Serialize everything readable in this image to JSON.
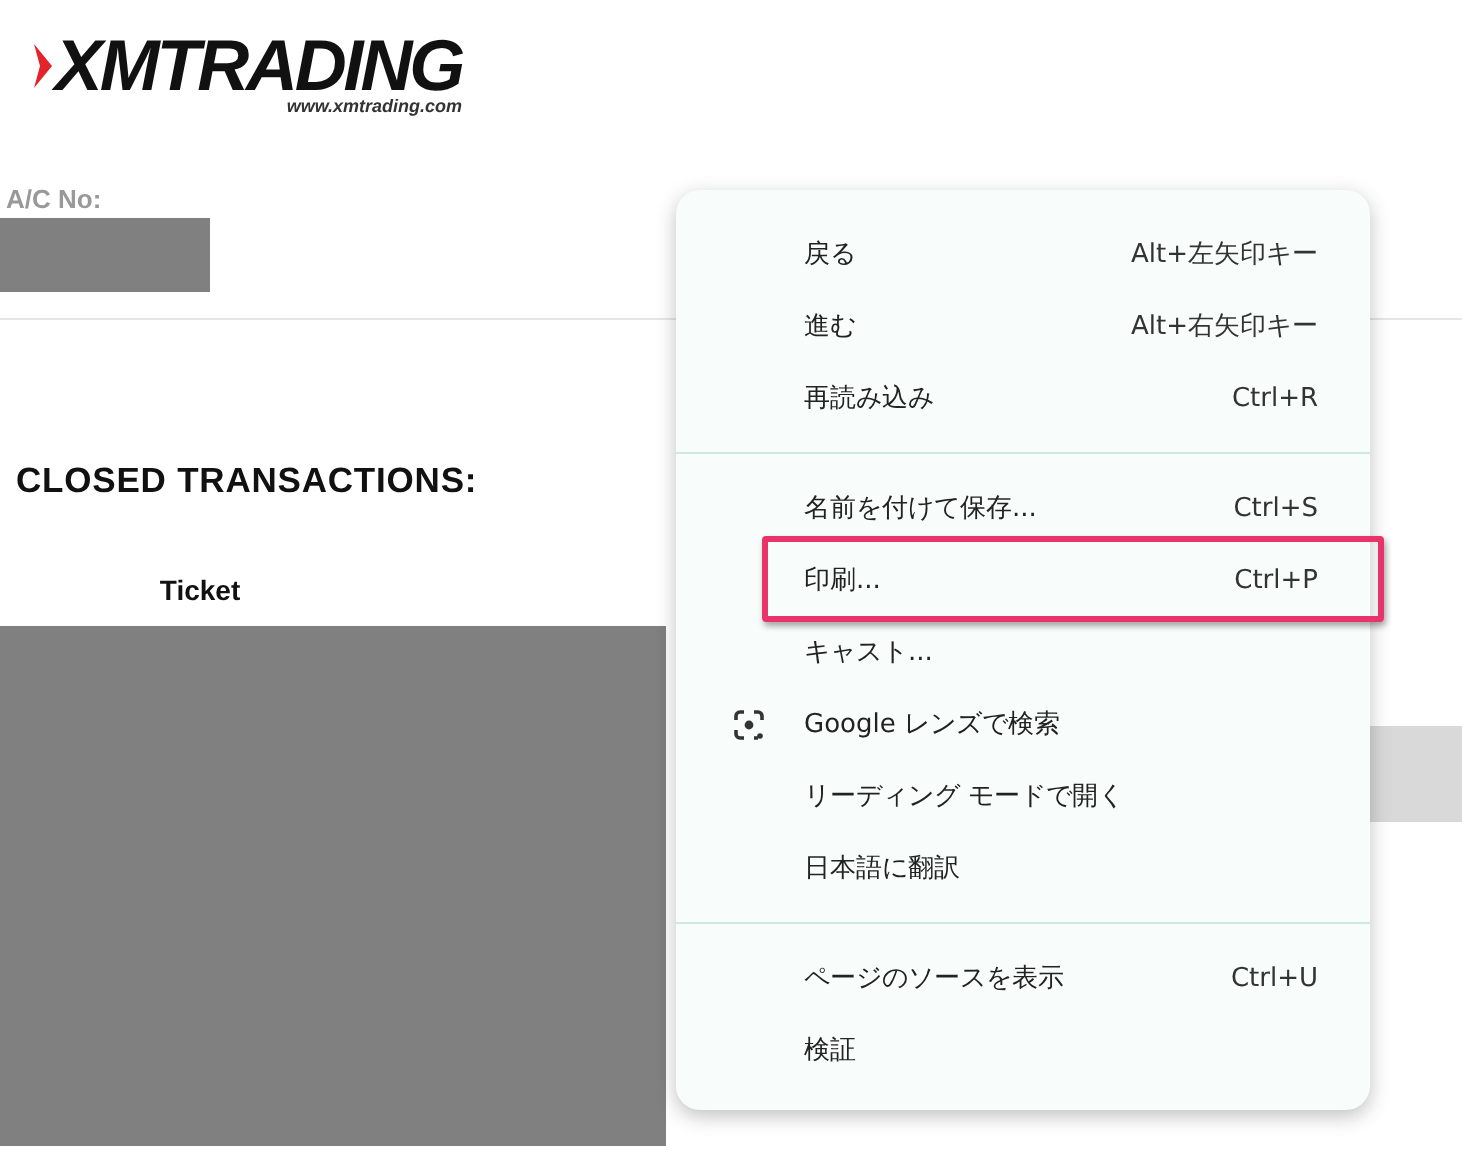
{
  "logo": {
    "name": "XMTRADING",
    "url": "www.xmtrading.com"
  },
  "account": {
    "label": "A/C No:"
  },
  "section_title": "CLOSED TRANSACTIONS:",
  "table": {
    "columns": [
      "Ticket"
    ]
  },
  "context_menu": {
    "groups": [
      [
        {
          "label": "戻る",
          "shortcut": "Alt+左矢印キー",
          "highlighted": false
        },
        {
          "label": "進む",
          "shortcut": "Alt+右矢印キー",
          "highlighted": false
        },
        {
          "label": "再読み込み",
          "shortcut": "Ctrl+R",
          "highlighted": false
        }
      ],
      [
        {
          "label": "名前を付けて保存...",
          "shortcut": "Ctrl+S",
          "highlighted": false
        },
        {
          "label": "印刷...",
          "shortcut": "Ctrl+P",
          "highlighted": true
        },
        {
          "label": "キャスト...",
          "highlighted": false
        },
        {
          "label": "Google レンズで検索",
          "kind": "lens",
          "highlighted": false
        },
        {
          "label": "リーディング モードで開く",
          "highlighted": false
        },
        {
          "label": "日本語に翻訳",
          "highlighted": false
        }
      ],
      [
        {
          "label": "ページのソースを表示",
          "shortcut": "Ctrl+U",
          "highlighted": false
        },
        {
          "label": "検証",
          "highlighted": false
        }
      ]
    ]
  }
}
